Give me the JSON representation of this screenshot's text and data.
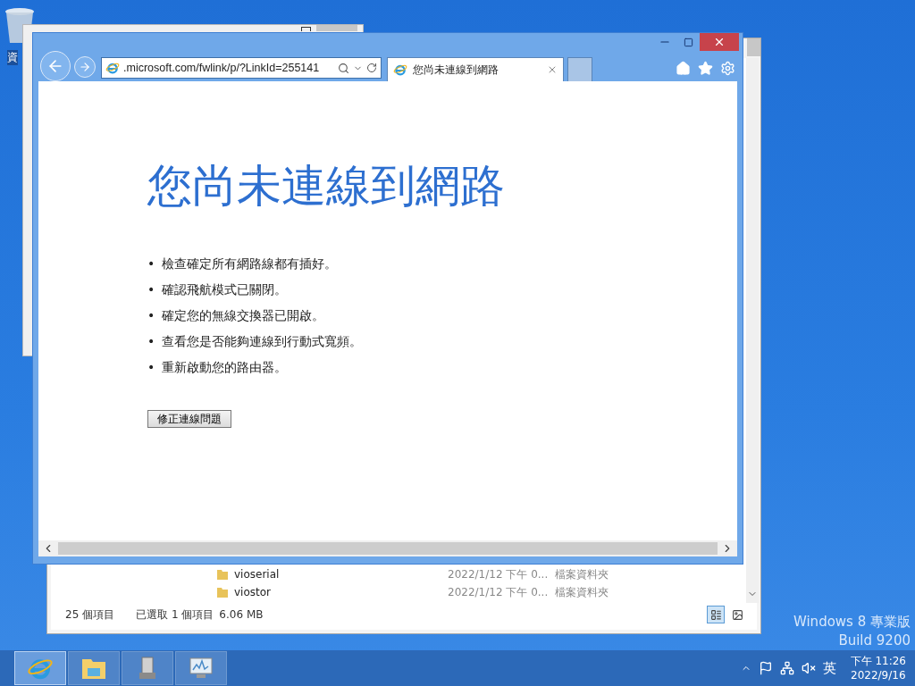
{
  "desktop": {
    "icons": [
      {
        "label": "資"
      }
    ],
    "watermark": [
      "Windows 8 專業版",
      "Build 9200"
    ]
  },
  "explorer": {
    "rows": [
      {
        "name": "vioserial",
        "date": "2022/1/12 下午 0...",
        "type": "檔案資料夾"
      },
      {
        "name": "viostor",
        "date": "2022/1/12 下午 0...",
        "type": "檔案資料夾"
      }
    ],
    "status_bar": {
      "count": "25 個項目",
      "selection": "已選取 1 個項目",
      "size": "6.06 MB"
    },
    "views": [
      {
        "kind": "details",
        "selected": true
      },
      {
        "kind": "thumbnails",
        "selected": false
      }
    ]
  },
  "browser": {
    "address": ".microsoft.com/fwlink/p/?LinkId=255141",
    "tabs": [
      {
        "title": "您尚未連線到網路",
        "selected": true
      }
    ],
    "page": {
      "heading": "您尚未連線到網路",
      "tips": [
        {
          "marker": "•",
          "text": "檢查確定所有網路線都有插好。"
        },
        {
          "marker": "•",
          "text": "確認飛航模式已關閉。"
        },
        {
          "marker": "•",
          "text": "確定您的無線交換器已開啟。"
        },
        {
          "marker": "•",
          "text": "查看您是否能夠連線到行動式寬頻。"
        },
        {
          "marker": "•",
          "text": "重新啟動您的路由器。"
        }
      ],
      "button": "修正連線問題"
    }
  },
  "taskbar": {
    "apps": [
      {
        "kind": "browser",
        "selected": true
      },
      {
        "kind": "explorer",
        "selected": false
      },
      {
        "kind": "server",
        "selected": false
      },
      {
        "kind": "monitor",
        "selected": false
      }
    ],
    "tray": {
      "ime": "英",
      "time": "下午 11:26",
      "date": "2022/9/16"
    }
  }
}
